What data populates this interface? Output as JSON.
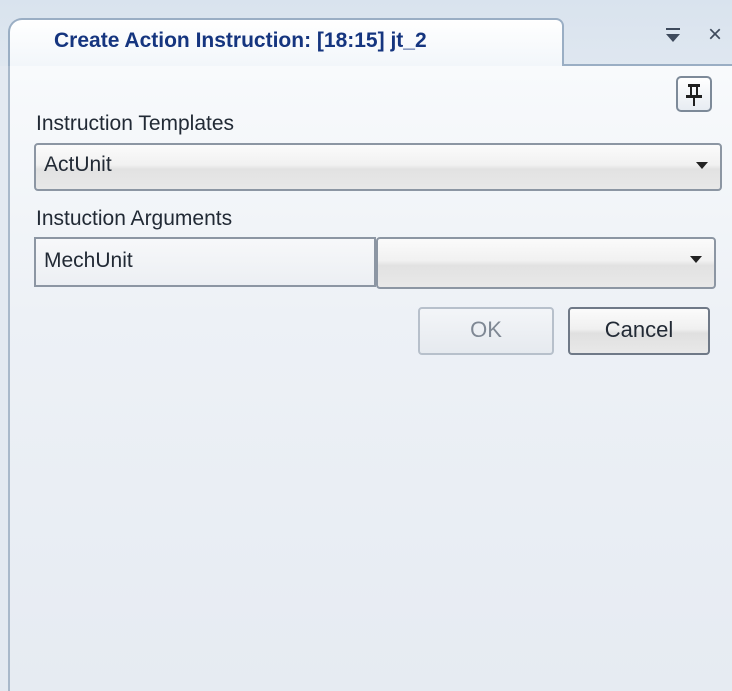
{
  "tab": {
    "title": "Create Action Instruction: [18:15] jt_2",
    "menu_icon": "dropdown-menu-icon",
    "close_glyph": "×"
  },
  "panel": {
    "pin_icon": "pin-icon",
    "templates": {
      "label": "Instruction Templates",
      "selected": "ActUnit"
    },
    "arguments": {
      "label": "Instuction Arguments",
      "rows": [
        {
          "name": "MechUnit",
          "value": ""
        }
      ]
    },
    "buttons": {
      "ok_label": "OK",
      "ok_enabled": false,
      "cancel_label": "Cancel"
    }
  },
  "colors": {
    "tab_title": "#15357f",
    "panel_bg": "#e6ebf2"
  }
}
